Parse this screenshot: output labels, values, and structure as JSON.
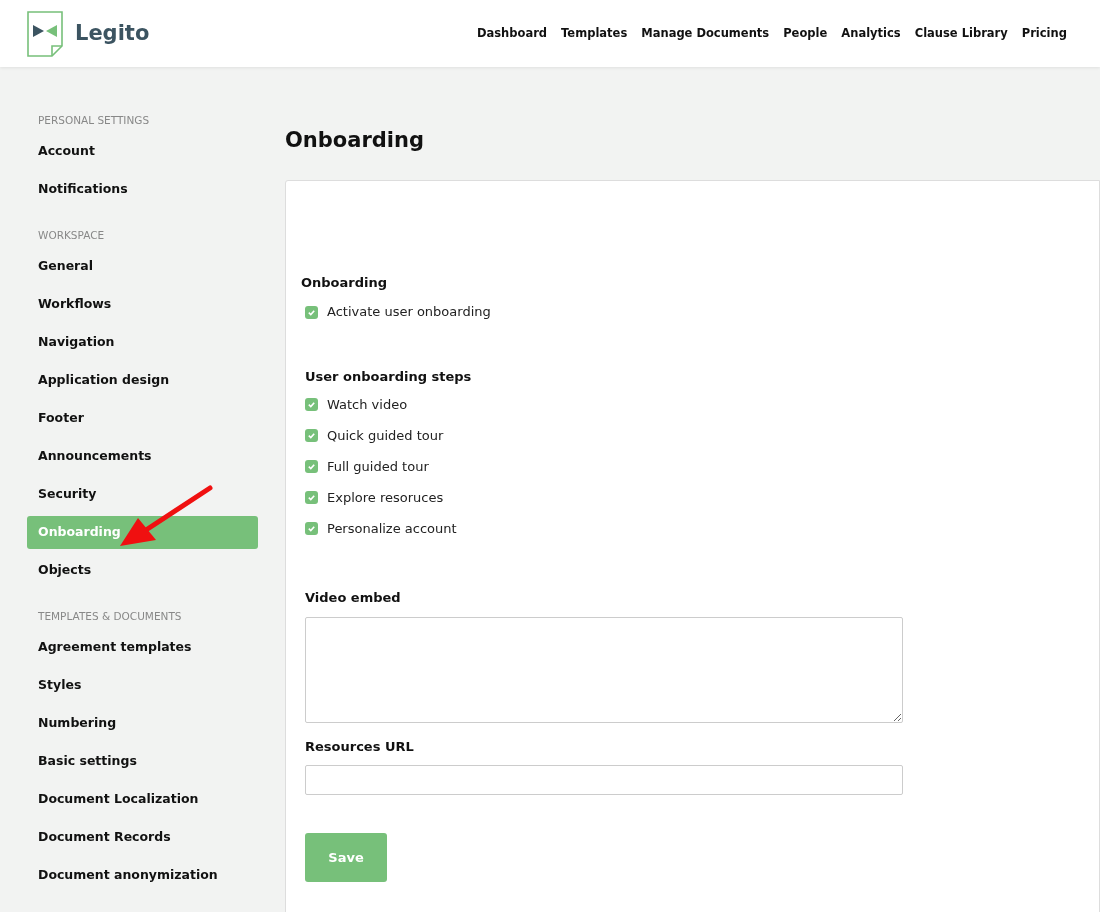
{
  "brand": {
    "name": "Legito"
  },
  "nav": [
    "Dashboard",
    "Templates",
    "Manage Documents",
    "People",
    "Analytics",
    "Clause Library",
    "Pricing"
  ],
  "sidebar": {
    "sections": [
      {
        "heading": "PERSONAL SETTINGS",
        "items": [
          {
            "label": "Account",
            "selected": false
          },
          {
            "label": "Notifications",
            "selected": false
          }
        ]
      },
      {
        "heading": "WORKSPACE",
        "items": [
          {
            "label": "General",
            "selected": false
          },
          {
            "label": "Workflows",
            "selected": false
          },
          {
            "label": "Navigation",
            "selected": false
          },
          {
            "label": "Application design",
            "selected": false
          },
          {
            "label": "Footer",
            "selected": false
          },
          {
            "label": "Announcements",
            "selected": false
          },
          {
            "label": "Security",
            "selected": false
          },
          {
            "label": "Onboarding",
            "selected": true
          },
          {
            "label": "Objects",
            "selected": false
          }
        ]
      },
      {
        "heading": "TEMPLATES & DOCUMENTS",
        "items": [
          {
            "label": "Agreement templates",
            "selected": false
          },
          {
            "label": "Styles",
            "selected": false
          },
          {
            "label": "Numbering",
            "selected": false
          },
          {
            "label": "Basic settings",
            "selected": false
          },
          {
            "label": "Document Localization",
            "selected": false
          },
          {
            "label": "Document Records",
            "selected": false
          },
          {
            "label": "Document anonymization",
            "selected": false
          }
        ]
      }
    ]
  },
  "page_title": "Onboarding",
  "onboarding": {
    "heading": "Onboarding",
    "options": [
      {
        "label": "Activate user onboarding",
        "checked": true
      }
    ]
  },
  "steps": {
    "heading": "User onboarding steps",
    "options": [
      {
        "label": "Watch video",
        "checked": true
      },
      {
        "label": "Quick guided tour",
        "checked": true
      },
      {
        "label": "Full guided tour",
        "checked": true
      },
      {
        "label": "Explore resoruces",
        "checked": true
      },
      {
        "label": "Personalize account",
        "checked": true
      }
    ]
  },
  "video_embed": {
    "label": "Video embed"
  },
  "resources_url": {
    "label": "Resources URL"
  },
  "save_button": "Save"
}
